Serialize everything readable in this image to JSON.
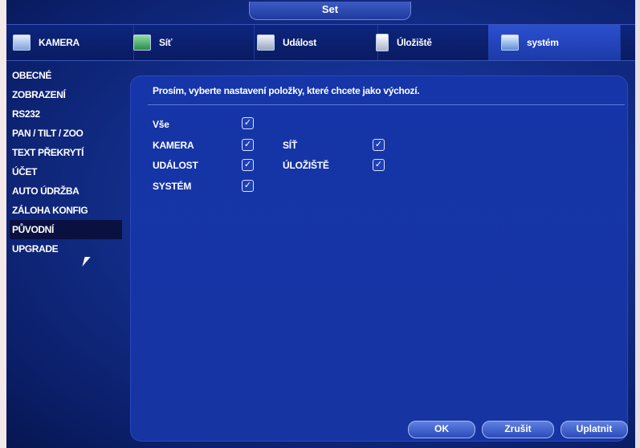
{
  "window": {
    "title": "Set"
  },
  "tabs": [
    {
      "label": "KAMERA",
      "icon": "camera-icon"
    },
    {
      "label": "Síť",
      "icon": "network-icon"
    },
    {
      "label": "Událost",
      "icon": "event-icon"
    },
    {
      "label": "Úložiště",
      "icon": "storage-icon"
    },
    {
      "label": "systém",
      "icon": "system-icon",
      "active": true
    }
  ],
  "sidebar": {
    "items": [
      {
        "label": "OBECNÉ"
      },
      {
        "label": "ZOBRAZENÍ"
      },
      {
        "label": "RS232"
      },
      {
        "label": "PAN / TILT / ZOO"
      },
      {
        "label": "TEXT PŘEKRYTÍ"
      },
      {
        "label": "ÚČET"
      },
      {
        "label": "AUTO ÚDRŽBA"
      },
      {
        "label": "ZÁLOHA KONFIG"
      },
      {
        "label": "PŮVODNÍ",
        "active": true
      },
      {
        "label": "UPGRADE"
      }
    ]
  },
  "main": {
    "prompt": "Prosím, vyberte nastavení položky, které chcete jako výchozí.",
    "options": {
      "all": {
        "label": "Vše",
        "checked": true
      },
      "camera": {
        "label": "KAMERA",
        "checked": true
      },
      "network": {
        "label": "SÍŤ",
        "checked": true
      },
      "event": {
        "label": "UDÁLOST",
        "checked": true
      },
      "storage": {
        "label": "ÚLOŽIŠTĚ",
        "checked": true
      },
      "system": {
        "label": "SYSTÉM",
        "checked": true
      }
    }
  },
  "buttons": {
    "ok": "OK",
    "cancel": "Zrušit",
    "apply": "Uplatnit"
  },
  "colors": {
    "background": "#14308f",
    "active_tab": "#2c4fd0",
    "selected_item": "#0a1040"
  }
}
